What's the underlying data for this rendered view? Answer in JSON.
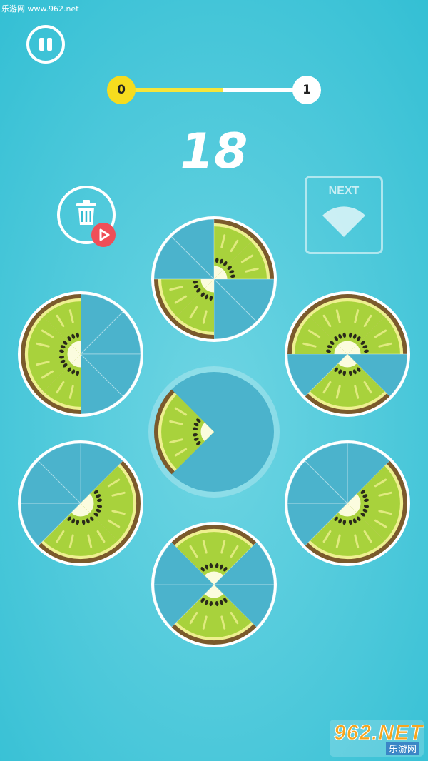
{
  "watermark_top": "乐游网 www.962.net",
  "level_progress": {
    "from_level": "0",
    "to_level": "1",
    "fraction": 0.55
  },
  "score": "18",
  "next_label": "NEXT",
  "watermark_bottom": {
    "brand": "962.NET",
    "sub": "乐游网"
  },
  "colors": {
    "kiwi_skin": "#7b5a2c",
    "kiwi_ring": "#eef090",
    "kiwi_flesh": "#a8d23c",
    "kiwi_core": "#fbfcde",
    "kiwi_seed": "#2a2a1a",
    "empty_slot": "#4bb3cc",
    "accent_yellow": "#f6dc1e",
    "ad_red": "#ef4f58"
  },
  "boards": [
    {
      "name": "board-top",
      "filled": [
        0,
        1,
        4,
        5
      ]
    },
    {
      "name": "board-upper-left",
      "filled": [
        4,
        5,
        6,
        7
      ]
    },
    {
      "name": "board-upper-right",
      "filled": [
        0,
        1,
        3,
        4,
        6,
        7
      ]
    },
    {
      "name": "board-lower-left",
      "filled": [
        1,
        2,
        3,
        4
      ]
    },
    {
      "name": "board-lower-right",
      "filled": [
        1,
        2,
        3,
        4
      ]
    },
    {
      "name": "board-bottom",
      "filled": [
        0,
        7,
        3,
        4
      ]
    },
    {
      "name": "board-center",
      "filled": [
        5,
        6
      ]
    }
  ]
}
